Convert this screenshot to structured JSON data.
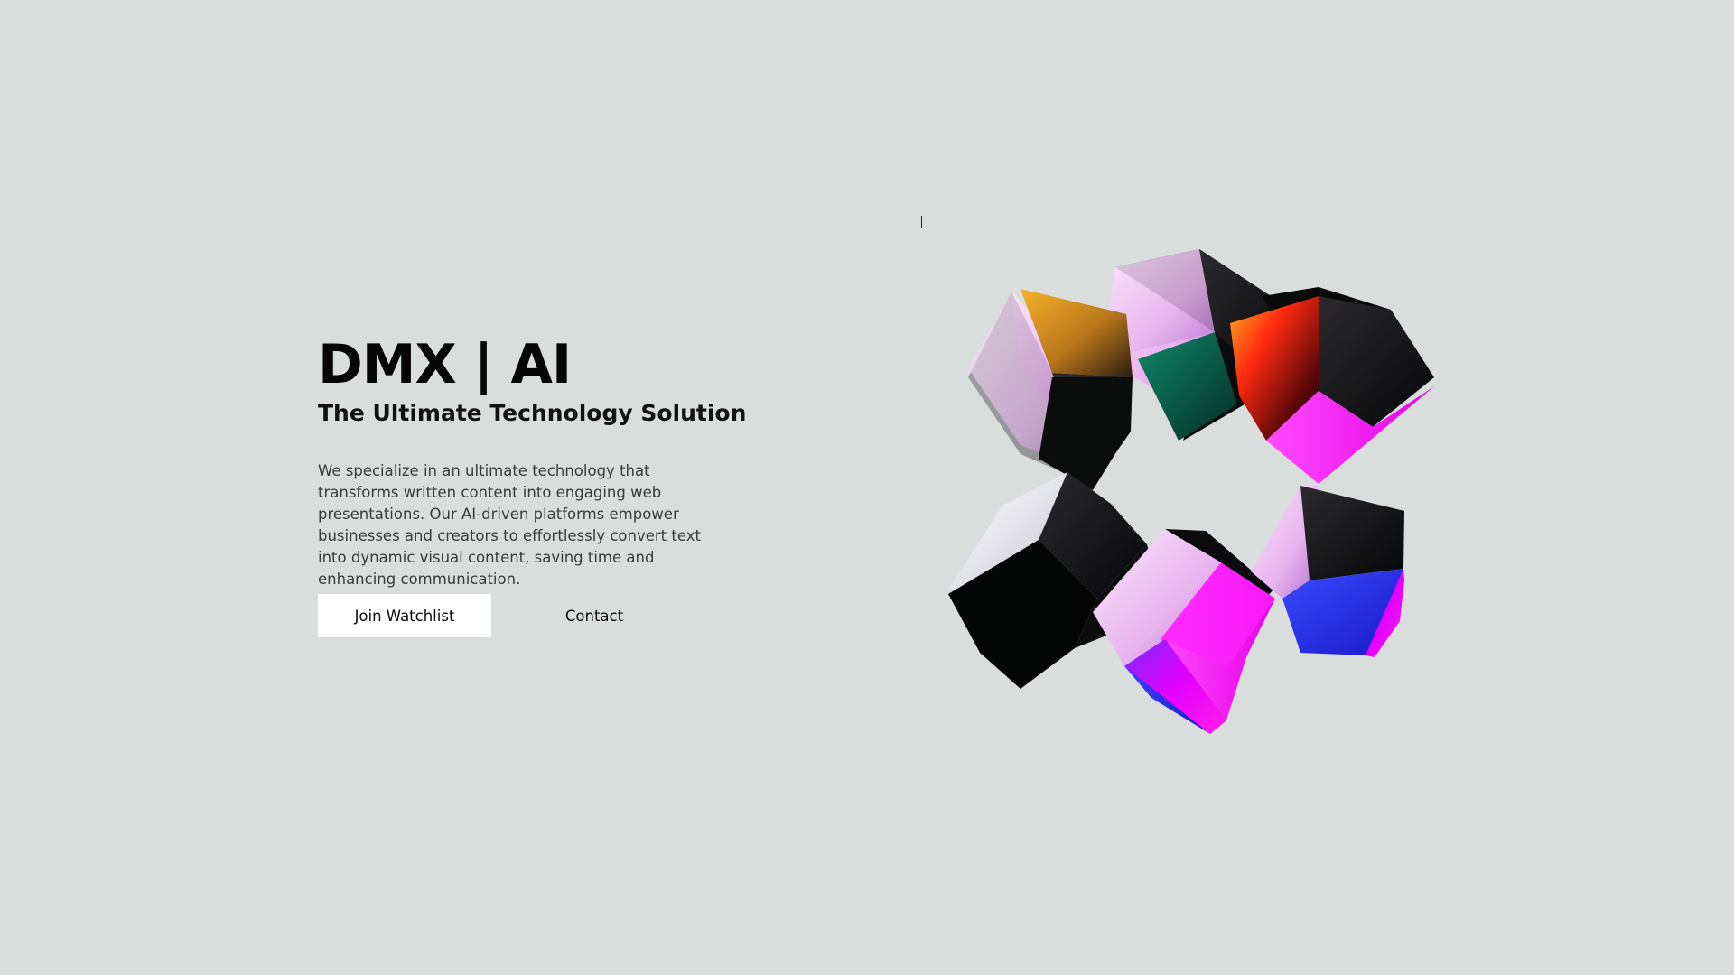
{
  "hero": {
    "title": "DMX | AI",
    "subtitle": "The Ultimate Technology Solution",
    "description": "We specialize in an ultimate technology that transforms written content into engaging web presentations. Our AI-driven platforms empower businesses and creators to effortlessly convert text into dynamic visual content, saving time and enhancing communication."
  },
  "actions": {
    "primary_label": "Join Watchlist",
    "secondary_label": "Contact"
  },
  "colors": {
    "background": "#d9dedd",
    "primary_button_bg": "#ffffff",
    "text": "#050505"
  },
  "illustration": {
    "icon": "iridescent-cubes-ring",
    "cube_count": 6
  }
}
